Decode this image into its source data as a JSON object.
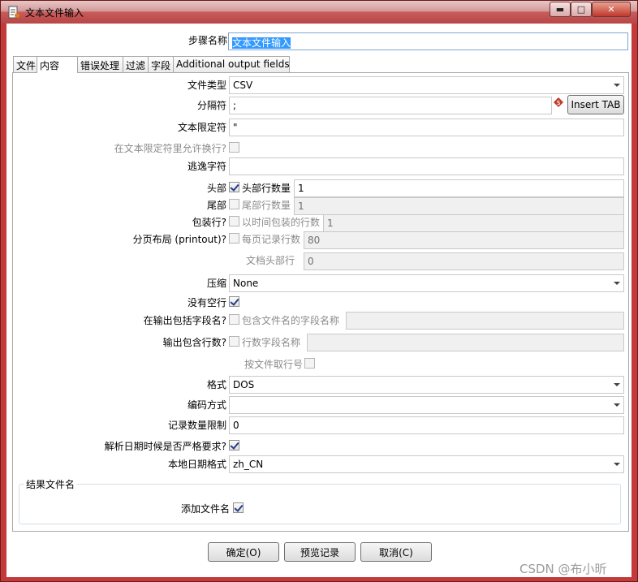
{
  "window": {
    "title": "文本文件输入"
  },
  "step_name": {
    "label": "步骤名称",
    "value": "文本文件输入"
  },
  "tabs": [
    {
      "label": "文件"
    },
    {
      "label": "内容"
    },
    {
      "label": "错误处理"
    },
    {
      "label": "过滤"
    },
    {
      "label": "字段"
    },
    {
      "label": "Additional output fields"
    }
  ],
  "content": {
    "file_type": {
      "label": "文件类型",
      "value": "CSV"
    },
    "separator": {
      "label": "分隔符",
      "value": ";",
      "insert_tab": "Insert TAB"
    },
    "enclosure": {
      "label": "文本限定符",
      "value": "\""
    },
    "allow_breaks": {
      "label": "在文本限定符里允许换行?"
    },
    "escape": {
      "label": "逃逸字符",
      "value": ""
    },
    "header": {
      "label": "头部",
      "sub_label": "头部行数量",
      "value": "1"
    },
    "footer": {
      "label": "尾部",
      "sub_label": "尾部行数量",
      "value": "1"
    },
    "wrapped": {
      "label": "包装行?",
      "sub_label": "以时间包装的行数",
      "value": "1"
    },
    "paged": {
      "label": "分页布局 (printout)?",
      "sub_label": "每页记录行数",
      "value": "80"
    },
    "doc_header": {
      "label": "文档头部行",
      "value": "0"
    },
    "compression": {
      "label": "压缩",
      "value": "None"
    },
    "no_empty": {
      "label": "没有空行"
    },
    "include_filename": {
      "label": "在输出包括字段名?",
      "sub_label": "包含文件名的字段名称",
      "value": ""
    },
    "include_rownum": {
      "label": "输出包含行数?",
      "sub_label": "行数字段名称",
      "value": ""
    },
    "rownum_by_file": {
      "label": "按文件取行号"
    },
    "format": {
      "label": "格式",
      "value": "DOS"
    },
    "encoding": {
      "label": "编码方式",
      "value": ""
    },
    "limit": {
      "label": "记录数量限制",
      "value": "0"
    },
    "lenient_date": {
      "label": "解析日期时候是否严格要求?"
    },
    "locale": {
      "label": "本地日期格式",
      "value": "zh_CN"
    },
    "result_group": {
      "title": "结果文件名",
      "add_label": "添加文件名"
    }
  },
  "buttons": {
    "ok": "确定(O)",
    "preview": "预览记录",
    "cancel": "取消(C)"
  },
  "watermark": "CSDN @布小昕"
}
